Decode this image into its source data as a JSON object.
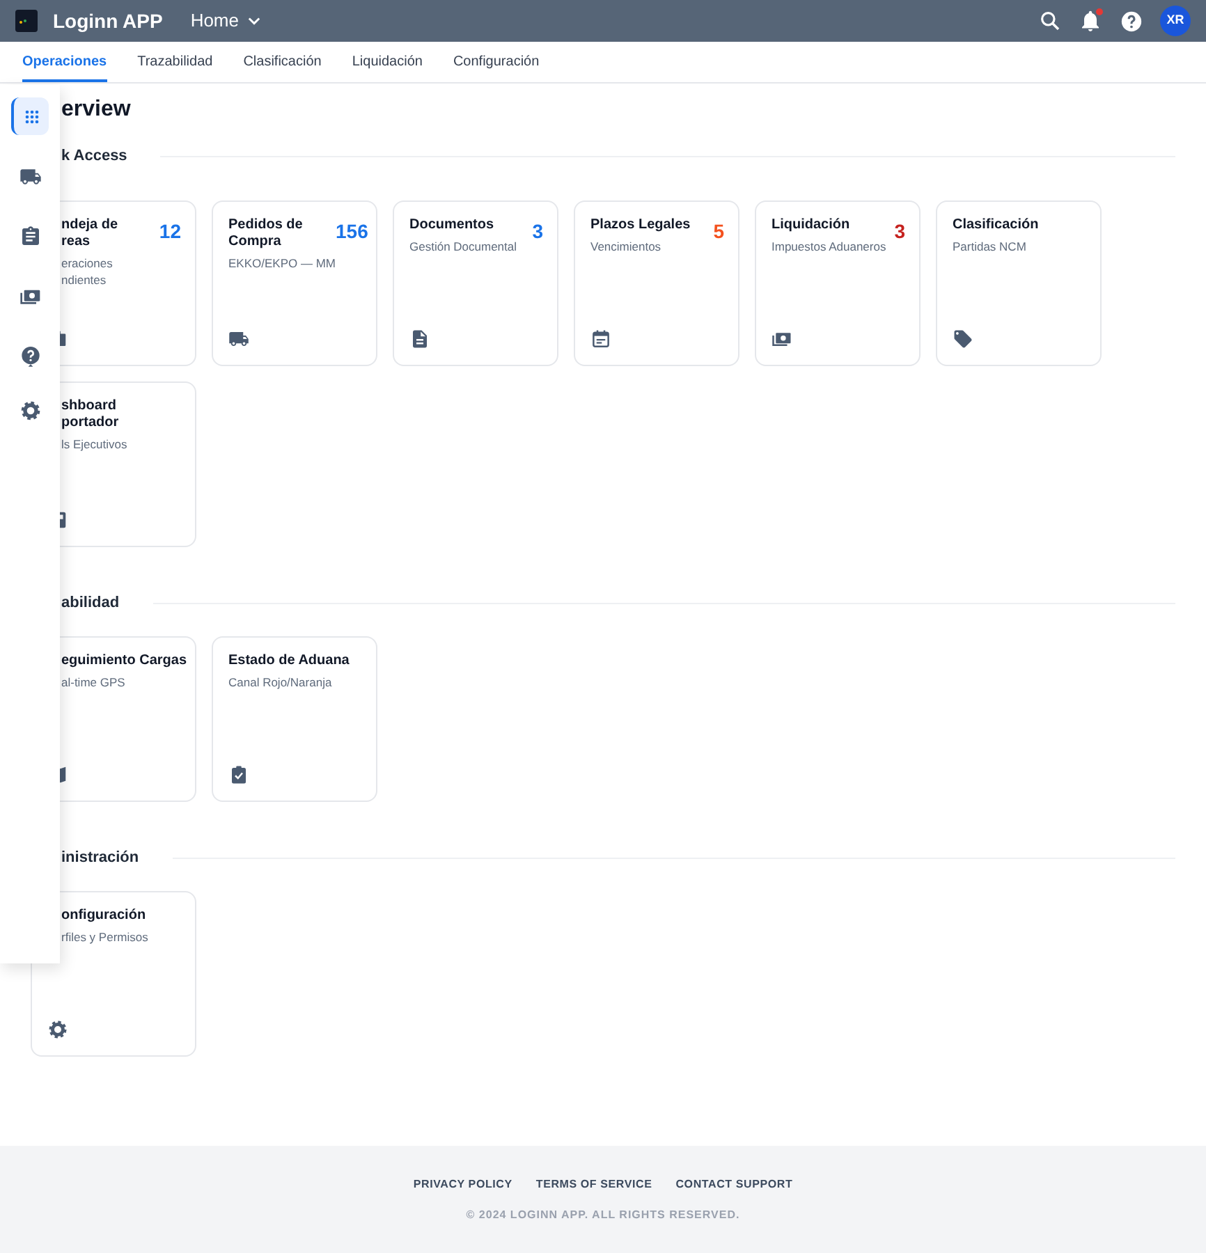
{
  "header": {
    "app_name": "Loginn APP",
    "menu": "Home",
    "avatar": "XR",
    "has_unread": true
  },
  "tabs": [
    {
      "label": "Operaciones",
      "selected": true
    },
    {
      "label": "Trazabilidad",
      "selected": false
    },
    {
      "label": "Clasificación",
      "selected": false
    },
    {
      "label": "Liquidación",
      "selected": false
    },
    {
      "label": "Configuración",
      "selected": false
    }
  ],
  "sidebar": {
    "items": [
      {
        "selected": true
      },
      {
        "selected": false
      },
      {
        "selected": false
      },
      {
        "selected": false
      },
      {
        "selected": false
      },
      {
        "selected": false
      }
    ]
  },
  "page_title": "erview",
  "sections": [
    {
      "title": "k Access",
      "cards": [
        {
          "title_lines": [
            "ndeja de",
            "reas"
          ],
          "subtitle_lines": [
            "eraciones",
            "ndientes"
          ],
          "count": "12",
          "color": "#1a73e8"
        },
        {
          "title_lines": [
            "Pedidos de",
            "Compra"
          ],
          "subtitle_lines": [
            "EKKO/EKPO — MM"
          ],
          "count": "156",
          "color": "#1a73e8"
        },
        {
          "title_lines": [
            "Documentos"
          ],
          "subtitle_lines": [
            "Gestión Documental"
          ],
          "count": "3",
          "color": "#1a73e8"
        },
        {
          "title_lines": [
            "Plazos Legales"
          ],
          "subtitle_lines": [
            "Vencimientos"
          ],
          "count": "5",
          "color": "#f4511e"
        },
        {
          "title_lines": [
            "Liquidación"
          ],
          "subtitle_lines": [
            "Impuestos Aduaneros"
          ],
          "count": "3",
          "color": "#c5221f"
        },
        {
          "title_lines": [
            "Clasificación"
          ],
          "subtitle_lines": [
            "Partidas NCM"
          ]
        },
        {
          "title_lines": [
            "shboard",
            "portador"
          ],
          "subtitle_lines": [
            "ls Ejecutivos"
          ]
        }
      ]
    },
    {
      "title": "abilidad",
      "cards": [
        {
          "title_lines": [
            "eguimiento Cargas"
          ],
          "subtitle_lines": [
            "al-time GPS"
          ]
        },
        {
          "title_lines": [
            "Estado de Aduana"
          ],
          "subtitle_lines": [
            "Canal Rojo/Naranja"
          ]
        }
      ]
    },
    {
      "title": "inistración",
      "cards": [
        {
          "title_lines": [
            "onfiguración"
          ],
          "subtitle_lines": [
            "rfiles y Permisos"
          ]
        }
      ]
    }
  ],
  "footer": {
    "links": [
      "PRIVACY POLICY",
      "TERMS OF SERVICE",
      "CONTACT SUPPORT"
    ],
    "copyright": "© 2024 LOGINN APP. ALL RIGHTS RESERVED."
  }
}
